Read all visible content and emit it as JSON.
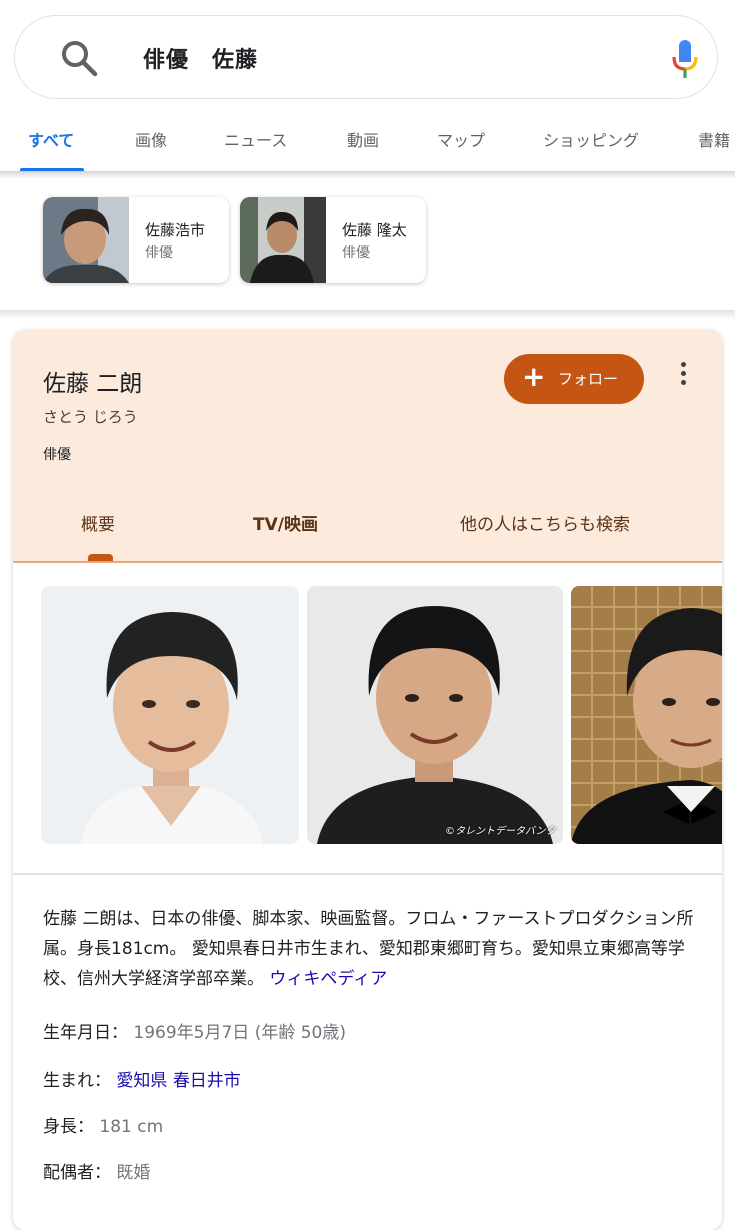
{
  "search": {
    "query": "俳優　佐藤",
    "icons": {
      "search": "search-icon",
      "mic": "mic-icon"
    }
  },
  "tabs": [
    {
      "label": "すべて",
      "active": true
    },
    {
      "label": "画像"
    },
    {
      "label": "ニュース"
    },
    {
      "label": "動画"
    },
    {
      "label": "マップ"
    },
    {
      "label": "ショッピング"
    },
    {
      "label": "書籍"
    }
  ],
  "related": [
    {
      "name": "佐藤浩市",
      "role": "俳優"
    },
    {
      "name": "佐藤 隆太",
      "role": "俳優"
    }
  ],
  "panel": {
    "name": "佐藤 二朗",
    "reading": "さとう じろう",
    "type": "俳優",
    "follow_plus": "+",
    "follow_label": "フォロー",
    "tabs": [
      "概要",
      "TV/映画",
      "他の人はこちらも検索"
    ],
    "photo_watermark": "©タレントデータバンク",
    "description": "佐藤 二朗は、日本の俳優、脚本家、映画監督。フロム・ファーストプロダクション所属。身長181cm。 愛知県春日井市生まれ、愛知郡東郷町育ち。愛知県立東郷高等学校、信州大学経済学部卒業。",
    "description_link": "ウィキペディア",
    "facts": {
      "birth": {
        "label": "生年月日：",
        "value": "1969年5月7日 (年齢 50歳)"
      },
      "born": {
        "label": "生まれ：",
        "link1": "愛知県",
        "link2": "春日井市"
      },
      "height": {
        "label": "身長：",
        "value": "181 cm"
      },
      "spouse": {
        "label": "配偶者：",
        "value": "既婚"
      }
    }
  },
  "colors": {
    "accent_blue": "#1a73e8",
    "panel_header": "#fcebdd",
    "follow_button": "#c55512",
    "link": "#1a0dab"
  }
}
